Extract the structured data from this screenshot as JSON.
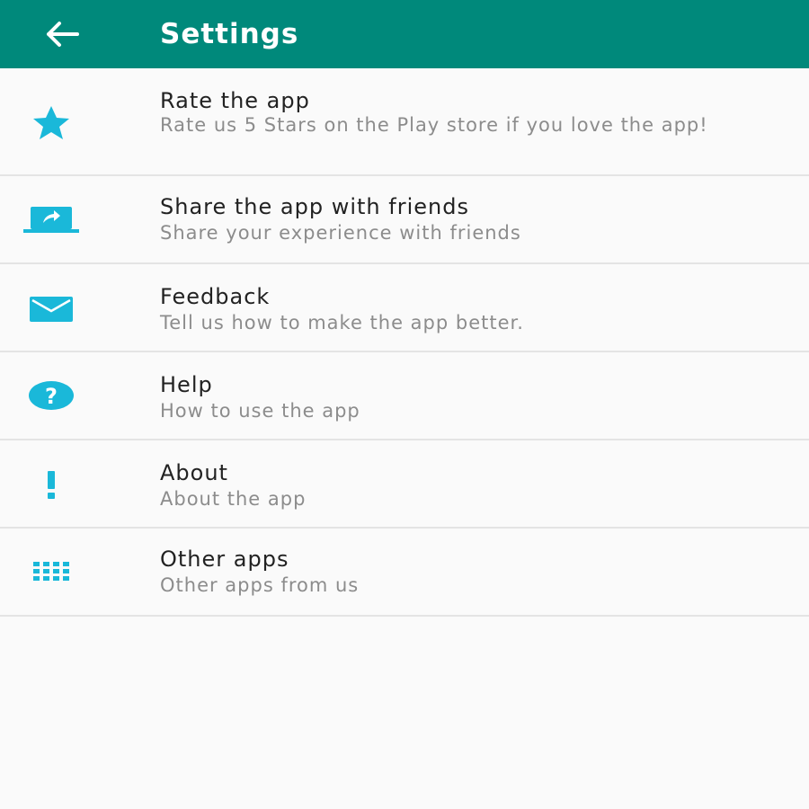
{
  "app_bar": {
    "title": "Settings",
    "back_icon": "arrow-back-icon",
    "color": "#00897b"
  },
  "accent_color": "#1ab8d9",
  "items": [
    {
      "title": "Rate the app",
      "subtitle": "Rate us 5 Stars on the Play store if you love the app!",
      "icon": "star-icon"
    },
    {
      "title": "Share the app with friends",
      "subtitle": "Share your experience with friends",
      "icon": "share-screen-icon"
    },
    {
      "title": "Feedback",
      "subtitle": "Tell us how to make the app better.",
      "icon": "mail-icon"
    },
    {
      "title": "Help",
      "subtitle": "How to use the app",
      "icon": "help-icon"
    },
    {
      "title": "About",
      "subtitle": "About the app",
      "icon": "info-icon"
    },
    {
      "title": "Other apps",
      "subtitle": "Other apps from us",
      "icon": "apps-grid-icon"
    }
  ]
}
